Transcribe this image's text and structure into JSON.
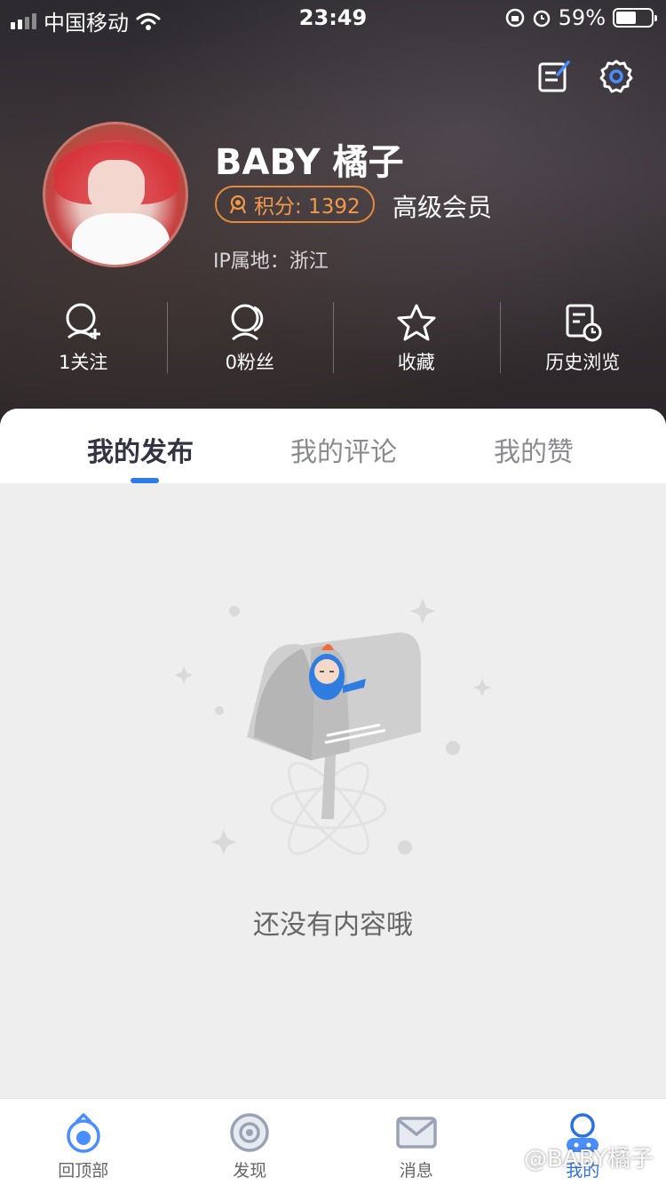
{
  "status_bar": {
    "carrier": "中国移动",
    "time": "23:49",
    "battery": "59%",
    "battery_level": 0.59
  },
  "profile": {
    "name": "BABY 橘子",
    "points_label": "积分: 1392",
    "member_level": "高级会员",
    "ip_location": "IP属地：浙江"
  },
  "stats": [
    {
      "label": "1关注",
      "icon": "follow-icon"
    },
    {
      "label": "0粉丝",
      "icon": "fans-icon"
    },
    {
      "label": "收藏",
      "icon": "star-icon"
    },
    {
      "label": "历史浏览",
      "icon": "history-icon"
    }
  ],
  "tabs": [
    {
      "label": "我的发布",
      "active": true
    },
    {
      "label": "我的评论",
      "active": false
    },
    {
      "label": "我的赞",
      "active": false
    }
  ],
  "empty_state": {
    "text": "还没有内容哦"
  },
  "tabbar": [
    {
      "label": "回顶部",
      "icon": "back-to-top-icon",
      "active": false
    },
    {
      "label": "发现",
      "icon": "discover-icon",
      "active": false
    },
    {
      "label": "消息",
      "icon": "message-icon",
      "active": false
    },
    {
      "label": "我的",
      "icon": "profile-icon",
      "active": true
    }
  ],
  "watermark": "@BABY橘子",
  "colors": {
    "accent": "#2e6fe0",
    "points": "#f39a4a"
  }
}
